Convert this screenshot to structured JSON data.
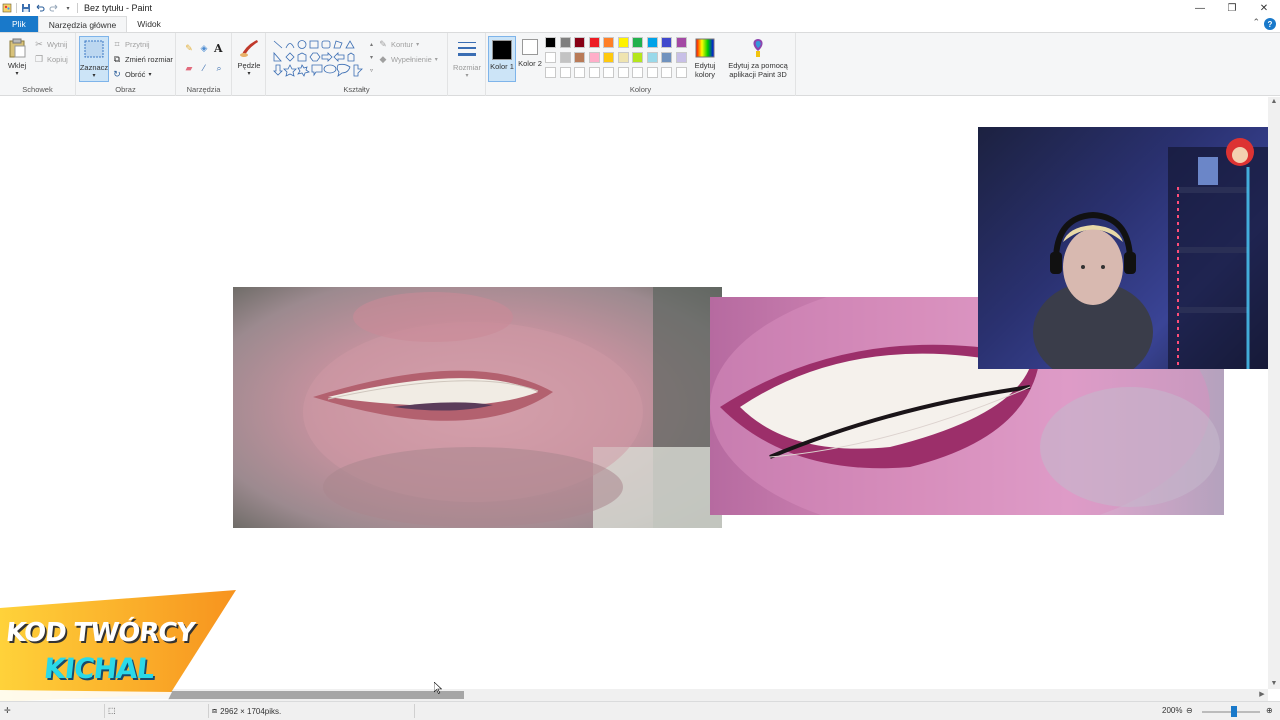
{
  "window": {
    "title": "Bez tytułu - Paint"
  },
  "tabs": [
    {
      "label": "Plik"
    },
    {
      "label": "Narzędzia główne"
    },
    {
      "label": "Widok"
    }
  ],
  "help": {
    "label": "?"
  },
  "ribbon": {
    "clipboard": {
      "group": "Schowek",
      "paste": "Wklej",
      "cut": "Wytnij",
      "copy": "Kopiuj"
    },
    "image": {
      "group": "Obraz",
      "select": "Zaznacz",
      "crop": "Przytnij",
      "resize": "Zmień rozmiar",
      "rotate": "Obróć"
    },
    "tools": {
      "group": "Narzędzia",
      "text_tool": "A"
    },
    "brushes": {
      "label": "Pędzle"
    },
    "shapes": {
      "group": "Kształty",
      "outline": "Kontur",
      "fill": "Wypełnienie"
    },
    "size": {
      "label": "Rozmiar"
    },
    "colors": {
      "group": "Kolory",
      "color1_label": "Kolor 1",
      "color2_label": "Kolor 2",
      "color1": "#000000",
      "color2": "#ffffff",
      "edit_colors": "Edytuj kolory",
      "paint3d": "Edytuj za pomocą aplikacji Paint 3D",
      "palette_row1": [
        "#000000",
        "#7f7f7f",
        "#880015",
        "#ed1c24",
        "#ff7f27",
        "#fff200",
        "#22b14c",
        "#00a2e8",
        "#3f48cc",
        "#a349a4"
      ],
      "palette_row2": [
        "#ffffff",
        "#c3c3c3",
        "#b97a57",
        "#ffaec9",
        "#ffc90e",
        "#efe4b0",
        "#b5e61d",
        "#99d9ea",
        "#7092be",
        "#c8bfe7"
      ],
      "palette_row3": [
        "#ffffff",
        "#ffffff",
        "#ffffff",
        "#ffffff",
        "#ffffff",
        "#ffffff",
        "#ffffff",
        "#ffffff",
        "#ffffff",
        "#ffffff"
      ]
    }
  },
  "overlay": {
    "line1": "KOD TWÓRCY",
    "line2": "KICHAL"
  },
  "status": {
    "dimensions": "2962 × 1704piks.",
    "zoom": "200%"
  }
}
